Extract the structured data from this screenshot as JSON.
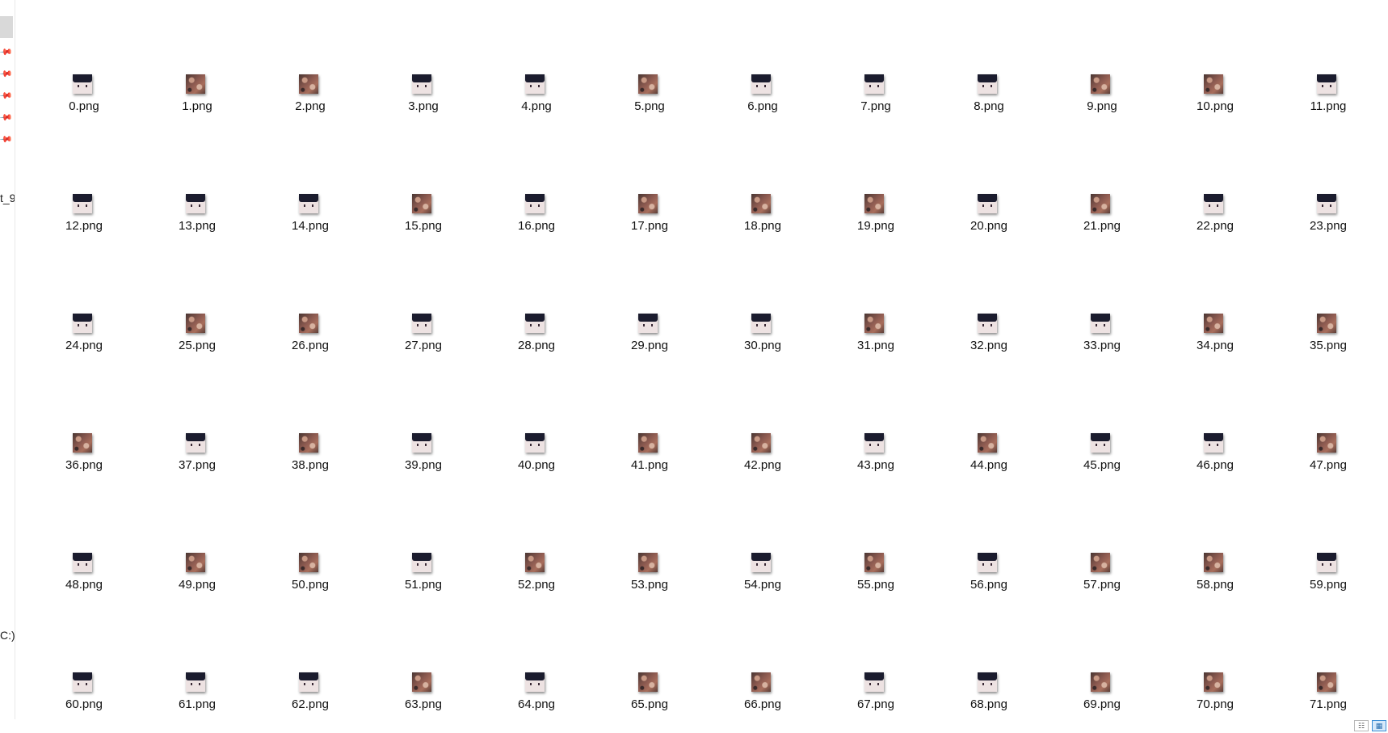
{
  "left_pane": {
    "pin_glyph": "📌",
    "fragment_1": "t_9",
    "fragment_2": "C:)"
  },
  "files": [
    {
      "name": "0.png",
      "thumb": "face"
    },
    {
      "name": "1.png",
      "thumb": "floral"
    },
    {
      "name": "2.png",
      "thumb": "floral"
    },
    {
      "name": "3.png",
      "thumb": "face"
    },
    {
      "name": "4.png",
      "thumb": "face"
    },
    {
      "name": "5.png",
      "thumb": "floral"
    },
    {
      "name": "6.png",
      "thumb": "face"
    },
    {
      "name": "7.png",
      "thumb": "face"
    },
    {
      "name": "8.png",
      "thumb": "face"
    },
    {
      "name": "9.png",
      "thumb": "floral"
    },
    {
      "name": "10.png",
      "thumb": "floral"
    },
    {
      "name": "11.png",
      "thumb": "face"
    },
    {
      "name": "12.png",
      "thumb": "face"
    },
    {
      "name": "13.png",
      "thumb": "face"
    },
    {
      "name": "14.png",
      "thumb": "face"
    },
    {
      "name": "15.png",
      "thumb": "floral"
    },
    {
      "name": "16.png",
      "thumb": "face"
    },
    {
      "name": "17.png",
      "thumb": "floral"
    },
    {
      "name": "18.png",
      "thumb": "floral"
    },
    {
      "name": "19.png",
      "thumb": "floral"
    },
    {
      "name": "20.png",
      "thumb": "face"
    },
    {
      "name": "21.png",
      "thumb": "floral"
    },
    {
      "name": "22.png",
      "thumb": "face"
    },
    {
      "name": "23.png",
      "thumb": "face"
    },
    {
      "name": "24.png",
      "thumb": "face"
    },
    {
      "name": "25.png",
      "thumb": "floral"
    },
    {
      "name": "26.png",
      "thumb": "floral"
    },
    {
      "name": "27.png",
      "thumb": "face"
    },
    {
      "name": "28.png",
      "thumb": "face"
    },
    {
      "name": "29.png",
      "thumb": "face"
    },
    {
      "name": "30.png",
      "thumb": "face"
    },
    {
      "name": "31.png",
      "thumb": "floral"
    },
    {
      "name": "32.png",
      "thumb": "face"
    },
    {
      "name": "33.png",
      "thumb": "face"
    },
    {
      "name": "34.png",
      "thumb": "floral"
    },
    {
      "name": "35.png",
      "thumb": "floral"
    },
    {
      "name": "36.png",
      "thumb": "floral"
    },
    {
      "name": "37.png",
      "thumb": "face"
    },
    {
      "name": "38.png",
      "thumb": "floral"
    },
    {
      "name": "39.png",
      "thumb": "face"
    },
    {
      "name": "40.png",
      "thumb": "face"
    },
    {
      "name": "41.png",
      "thumb": "floral"
    },
    {
      "name": "42.png",
      "thumb": "floral"
    },
    {
      "name": "43.png",
      "thumb": "face"
    },
    {
      "name": "44.png",
      "thumb": "floral"
    },
    {
      "name": "45.png",
      "thumb": "face"
    },
    {
      "name": "46.png",
      "thumb": "face"
    },
    {
      "name": "47.png",
      "thumb": "floral"
    },
    {
      "name": "48.png",
      "thumb": "face"
    },
    {
      "name": "49.png",
      "thumb": "floral"
    },
    {
      "name": "50.png",
      "thumb": "floral"
    },
    {
      "name": "51.png",
      "thumb": "face"
    },
    {
      "name": "52.png",
      "thumb": "floral"
    },
    {
      "name": "53.png",
      "thumb": "floral"
    },
    {
      "name": "54.png",
      "thumb": "face"
    },
    {
      "name": "55.png",
      "thumb": "floral"
    },
    {
      "name": "56.png",
      "thumb": "face"
    },
    {
      "name": "57.png",
      "thumb": "floral"
    },
    {
      "name": "58.png",
      "thumb": "floral"
    },
    {
      "name": "59.png",
      "thumb": "face"
    },
    {
      "name": "60.png",
      "thumb": "face"
    },
    {
      "name": "61.png",
      "thumb": "face"
    },
    {
      "name": "62.png",
      "thumb": "face"
    },
    {
      "name": "63.png",
      "thumb": "floral"
    },
    {
      "name": "64.png",
      "thumb": "face"
    },
    {
      "name": "65.png",
      "thumb": "floral"
    },
    {
      "name": "66.png",
      "thumb": "floral"
    },
    {
      "name": "67.png",
      "thumb": "face"
    },
    {
      "name": "68.png",
      "thumb": "face"
    },
    {
      "name": "69.png",
      "thumb": "floral"
    },
    {
      "name": "70.png",
      "thumb": "floral"
    },
    {
      "name": "71.png",
      "thumb": "floral"
    }
  ],
  "status_bar": {
    "details_view_glyph": "☷",
    "icons_view_glyph": "▦"
  }
}
